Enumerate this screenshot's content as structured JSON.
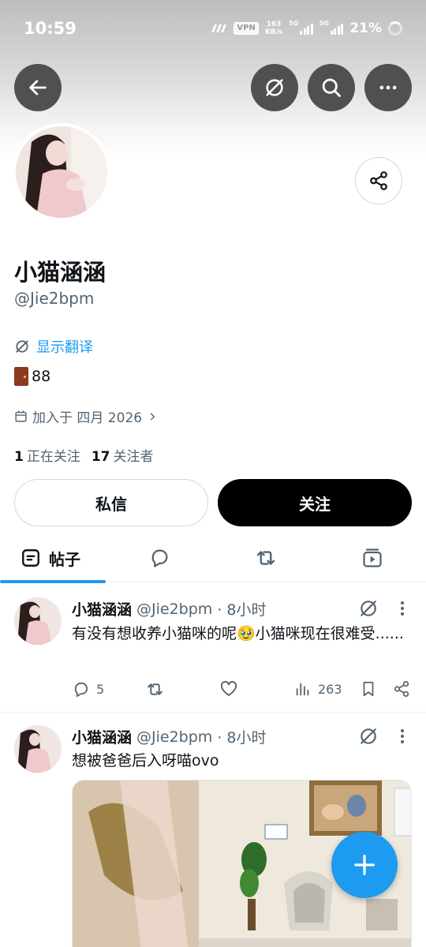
{
  "status_bar": {
    "time": "10:59",
    "vpn": "VPN",
    "speed_value": "163",
    "speed_unit": "KB/s",
    "signal1_label": "5G",
    "signal2_label": "5G",
    "battery": "21%"
  },
  "profile": {
    "display_name": "小猫涵涵",
    "handle": "@Jie2bpm",
    "translate_label": "显示翻译",
    "bio": "88",
    "joined": "加入于 四月 2026",
    "following_count": "1",
    "following_label": "正在关注",
    "followers_count": "17",
    "followers_label": "关注者",
    "message_button": "私信",
    "follow_button": "关注"
  },
  "tabs": {
    "posts_label": "帖子"
  },
  "tweets": [
    {
      "name": "小猫涵涵",
      "handle": "@Jie2bpm",
      "time": "· 8小时",
      "text": "有没有想收养小猫咪的呢🥹小猫咪现在很难受......",
      "replies": "5",
      "views": "263"
    },
    {
      "name": "小猫涵涵",
      "handle": "@Jie2bpm",
      "time": "· 8小时",
      "text": "想被爸爸后入呀喵ovo"
    }
  ],
  "colors": {
    "accent": "#1d9bf0",
    "text_primary": "#0f1419",
    "text_secondary": "#536471",
    "follow_button_bg": "#000000"
  },
  "icons": {
    "back": "arrow-left-icon",
    "grok": "grok-icon",
    "search": "search-icon",
    "more": "more-horizontal-icon",
    "share": "share-icon",
    "calendar": "calendar-icon",
    "compose": "plus-icon"
  }
}
